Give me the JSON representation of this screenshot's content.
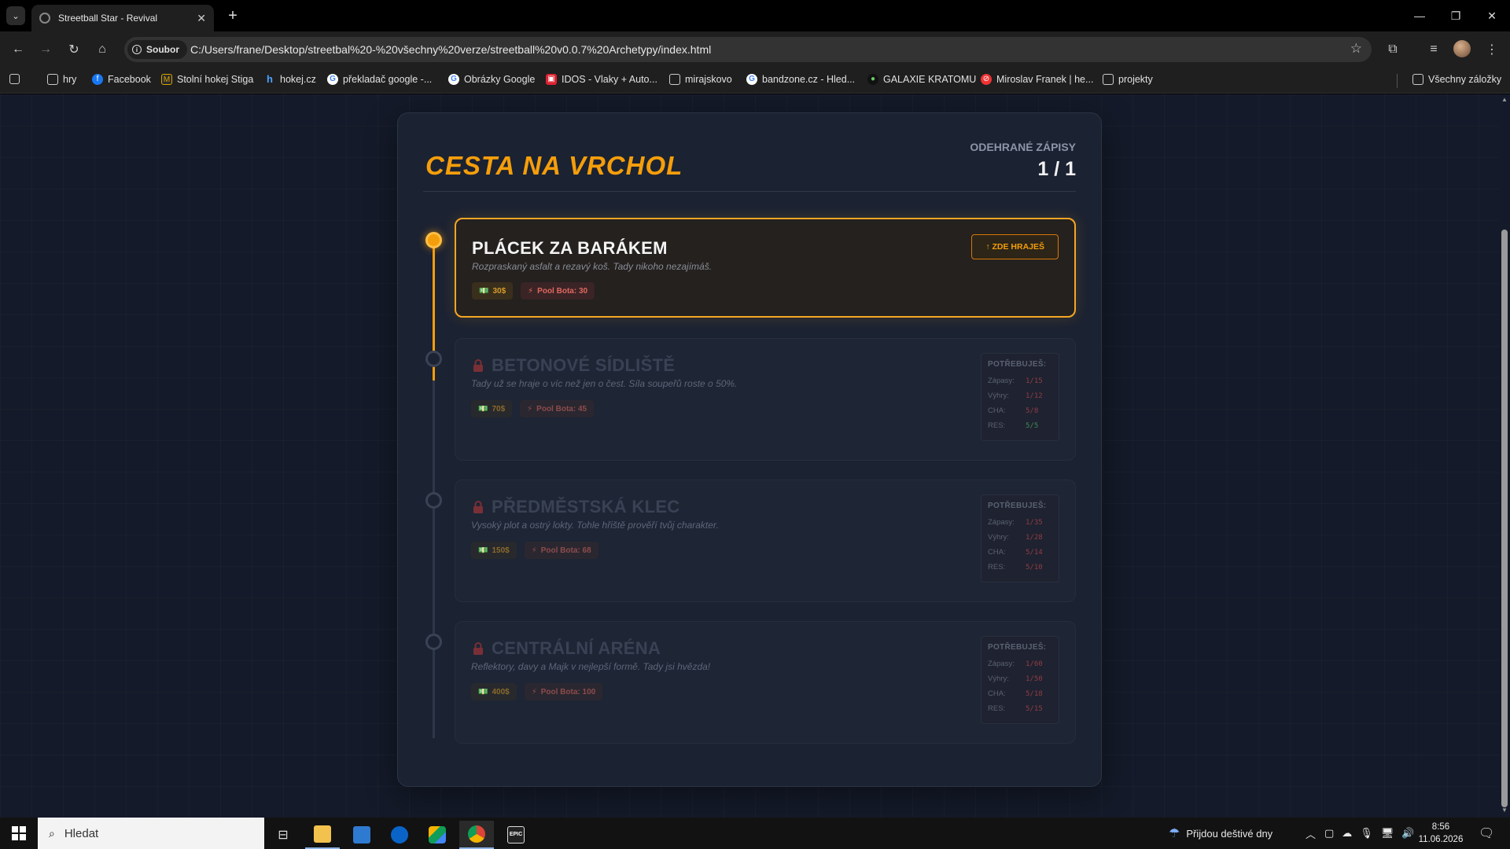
{
  "browser": {
    "tab_title": "Streetball Star - Revival",
    "address_chip": "Soubor",
    "url": "C:/Users/frane/Desktop/streetbal%20-%20všechny%20verze/streetball%20v0.0.7%20Archetypy/index.html",
    "bookmarks": [
      "hry",
      "Facebook",
      "Stolní hokej Stiga",
      "hokej.cz",
      "překladač google -...",
      "Obrázky Google",
      "IDOS - Vlaky + Auto...",
      "mirajskovo",
      "bandzone.cz - Hled...",
      "GALAXIE KRATOMU",
      "Miroslav Franek | he...",
      "projekty"
    ],
    "all_bookmarks": "Všechny záložky"
  },
  "page": {
    "title": "CESTA NA VRCHOL",
    "stat_label": "ODEHRANÉ ZÁPISY",
    "stat_value": "1 / 1",
    "req_title": "POTŘEBUJEŠ:",
    "here_label": "↑ ZDE HRAJEŠ",
    "stages": [
      {
        "name": "PLÁCEK ZA BARÁKEM",
        "desc": "Rozpraskaný asfalt a rezavý koš. Tady nikoho nezajímáš.",
        "money": "30$",
        "pool": "Pool Bota: 30",
        "status": "current"
      },
      {
        "name": "BETONOVÉ SÍDLIŠTĚ",
        "desc": "Tady už se hraje o víc než jen o čest. Síla soupeřů roste o 50%.",
        "money": "70$",
        "pool": "Pool Bota: 45",
        "status": "locked",
        "req": [
          {
            "k": "Zápasy:",
            "v": "1/15",
            "ok": false
          },
          {
            "k": "Výhry:",
            "v": "1/12",
            "ok": false
          },
          {
            "k": "CHA:",
            "v": "5/8",
            "ok": false
          },
          {
            "k": "RES:",
            "v": "5/5",
            "ok": true
          }
        ]
      },
      {
        "name": "PŘEDMĚSTSKÁ KLEC",
        "desc": "Vysoký plot a ostrý lokty. Tohle hřiště prověří tvůj charakter.",
        "money": "150$",
        "pool": "Pool Bota: 68",
        "status": "locked",
        "req": [
          {
            "k": "Zápasy:",
            "v": "1/35",
            "ok": false
          },
          {
            "k": "Výhry:",
            "v": "1/28",
            "ok": false
          },
          {
            "k": "CHA:",
            "v": "5/14",
            "ok": false
          },
          {
            "k": "RES:",
            "v": "5/10",
            "ok": false
          }
        ]
      },
      {
        "name": "CENTRÁLNÍ ARÉNA",
        "desc": "Reflektory, davy a Majk v nejlepší formě. Tady jsi hvězda!",
        "money": "400$",
        "pool": "Pool Bota: 100",
        "status": "locked",
        "req": [
          {
            "k": "Zápasy:",
            "v": "1/60",
            "ok": false
          },
          {
            "k": "Výhry:",
            "v": "1/50",
            "ok": false
          },
          {
            "k": "CHA:",
            "v": "5/18",
            "ok": false
          },
          {
            "k": "RES:",
            "v": "5/15",
            "ok": false
          }
        ]
      }
    ]
  },
  "taskbar": {
    "search_placeholder": "Hledat",
    "weather": "Přijdou deštivé dny",
    "time": "8:56",
    "date": "11.06.2026"
  },
  "colors": {
    "accent": "#f59e0b",
    "panel": "#1b2232",
    "background": "#141a29",
    "bad": "#8e3e45",
    "good": "#3f8a55"
  }
}
